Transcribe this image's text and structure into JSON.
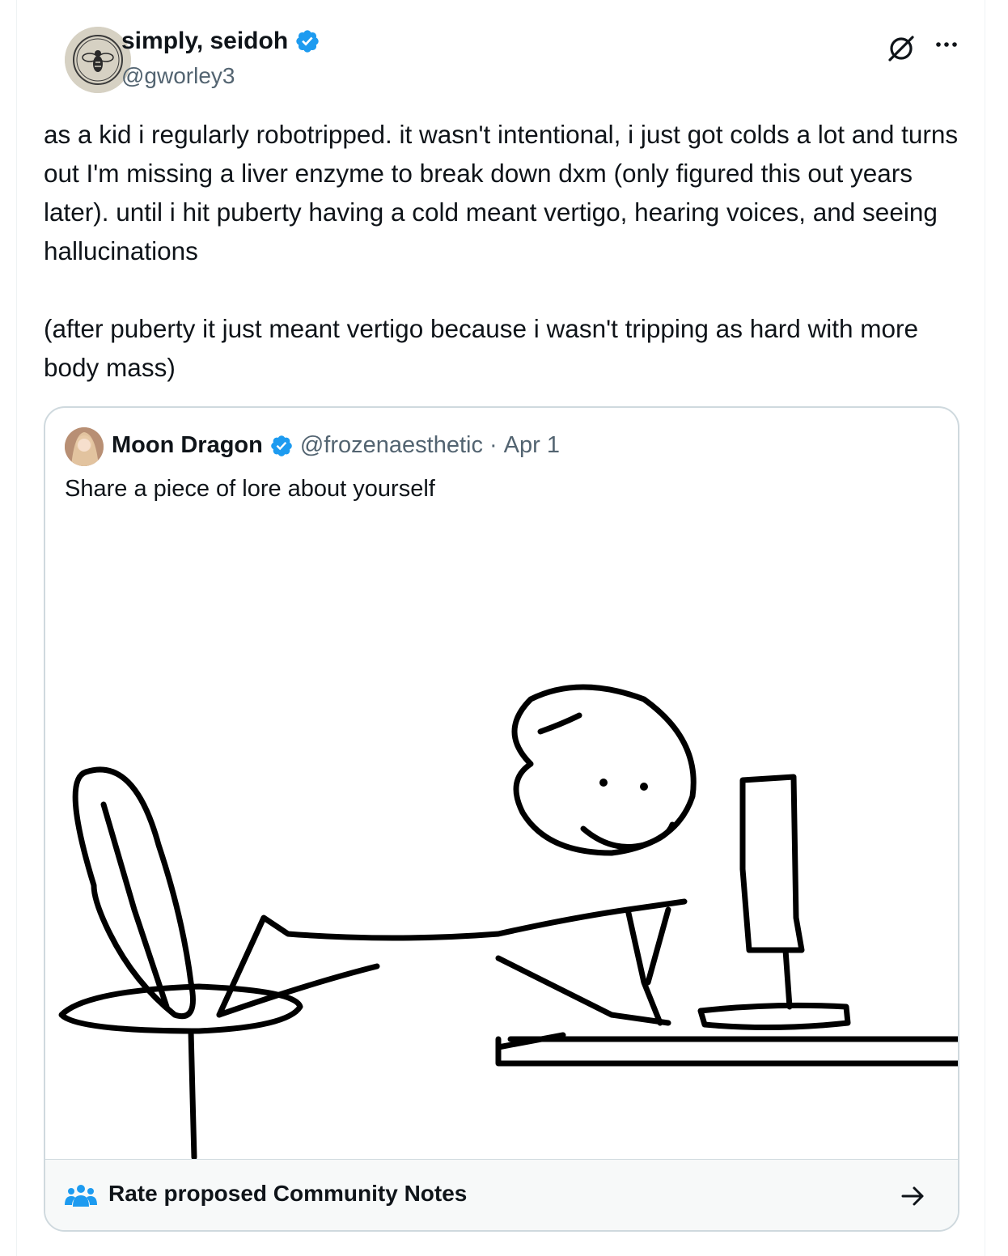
{
  "author": {
    "name": "simply, seidoh",
    "handle": "@gworley3",
    "verified": true
  },
  "tweet": {
    "text": "as a kid i regularly robotripped. it wasn't intentional, i just got colds a lot and turns out I'm missing a liver enzyme to break down dxm (only figured this out years later). until i hit puberty having a cold meant vertigo, hearing voices, and seeing hallucinations\n\n(after puberty it just meant vertigo because i wasn't tripping as hard with more body mass)"
  },
  "quote": {
    "name": "Moon Dragon",
    "handle": "@frozenaesthetic",
    "separator": "·",
    "date": "Apr 1",
    "text": "Share a piece of lore about yourself",
    "image_icon": "stick-figure-computer-meme"
  },
  "community_notes": {
    "label": "Rate proposed Community Notes"
  },
  "colors": {
    "verified_blue": "#1d9bf0",
    "secondary_text": "#536471",
    "border": "#cfd9de",
    "notes_bg": "#f7f9f9"
  }
}
